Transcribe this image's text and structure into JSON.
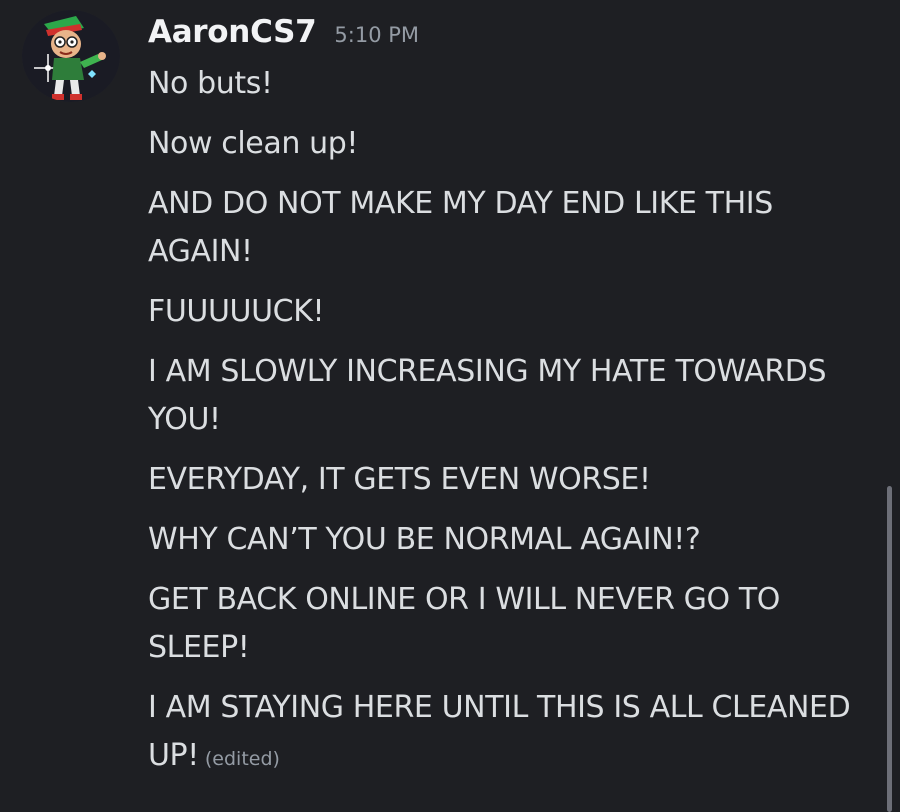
{
  "author": {
    "username": "AaronCS7",
    "timestamp": "5:10 PM",
    "avatar_icon": "cartoon-character-avatar"
  },
  "messages": [
    {
      "text": "No buts!"
    },
    {
      "text": "Now clean up!"
    },
    {
      "text": "AND DO NOT MAKE MY DAY END LIKE THIS AGAIN!"
    },
    {
      "text": "FUUUUUCK!"
    },
    {
      "text": "I AM SLOWLY INCREASING MY HATE TOWARDS YOU!"
    },
    {
      "text": "EVERYDAY, IT GETS EVEN WORSE!"
    },
    {
      "text": "WHY CAN’T YOU BE NORMAL AGAIN!?"
    },
    {
      "text": "GET BACK ONLINE OR I WILL NEVER GO TO SLEEP!"
    },
    {
      "text": "I AM STAYING HERE UNTIL THIS IS ALL CLEANED UP!",
      "edited_label": "(edited)"
    }
  ],
  "colors": {
    "background": "#1e1f23",
    "username": "#f2f3f5",
    "message_text": "#dbdee1",
    "muted": "#949ba4"
  }
}
